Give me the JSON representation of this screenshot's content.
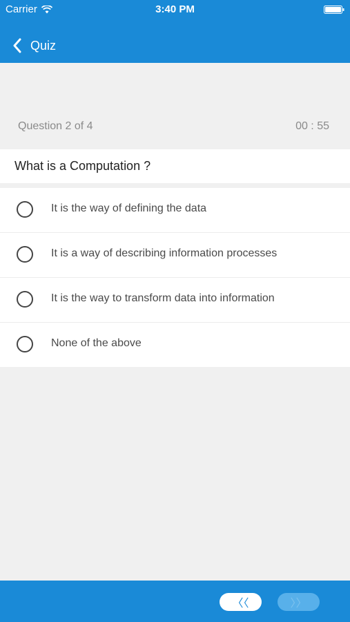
{
  "status_bar": {
    "carrier": "Carrier",
    "time": "3:40 PM"
  },
  "nav": {
    "back_icon": "chevron-left-icon",
    "title": "Quiz"
  },
  "quiz": {
    "progress": "Question 2 of 4",
    "timer": "00 : 55",
    "question": "What is a Computation ?",
    "options": [
      {
        "label": "It is the way of defining the data",
        "selected": false
      },
      {
        "label": "It is a way of describing information processes",
        "selected": false
      },
      {
        "label": "It is the way to transform data into information",
        "selected": false
      },
      {
        "label": "None of the above",
        "selected": false
      }
    ]
  },
  "footer": {
    "prev_label": "〈〈",
    "next_label": "〉〉",
    "next_enabled": false
  },
  "colors": {
    "accent": "#1a8ad7",
    "background": "#f0f0f0"
  }
}
